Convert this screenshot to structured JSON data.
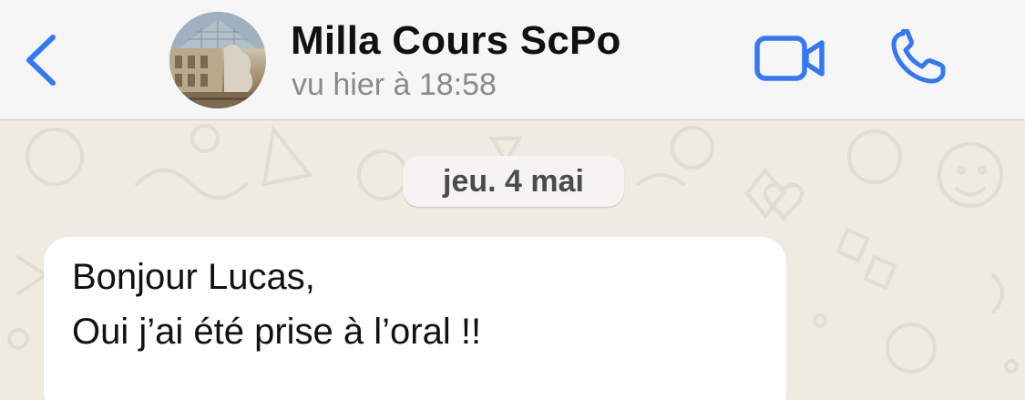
{
  "header": {
    "contact_name": "Milla Cours ScPo",
    "last_seen": "vu hier à 18:58",
    "back_icon": "chevron-left-icon",
    "video_icon": "video-camera-icon",
    "phone_icon": "phone-icon"
  },
  "chat": {
    "date_separator": "jeu. 4 mai",
    "messages": [
      {
        "direction": "incoming",
        "lines": [
          "Bonjour Lucas,",
          "Oui j’ai été prise à l’oral !!"
        ]
      }
    ]
  },
  "colors": {
    "accent": "#3478f6",
    "header_bg": "#f6f6f6",
    "chat_bg": "#efeae2",
    "bubble_bg": "#ffffff",
    "secondary_text": "#8a8a8e"
  }
}
